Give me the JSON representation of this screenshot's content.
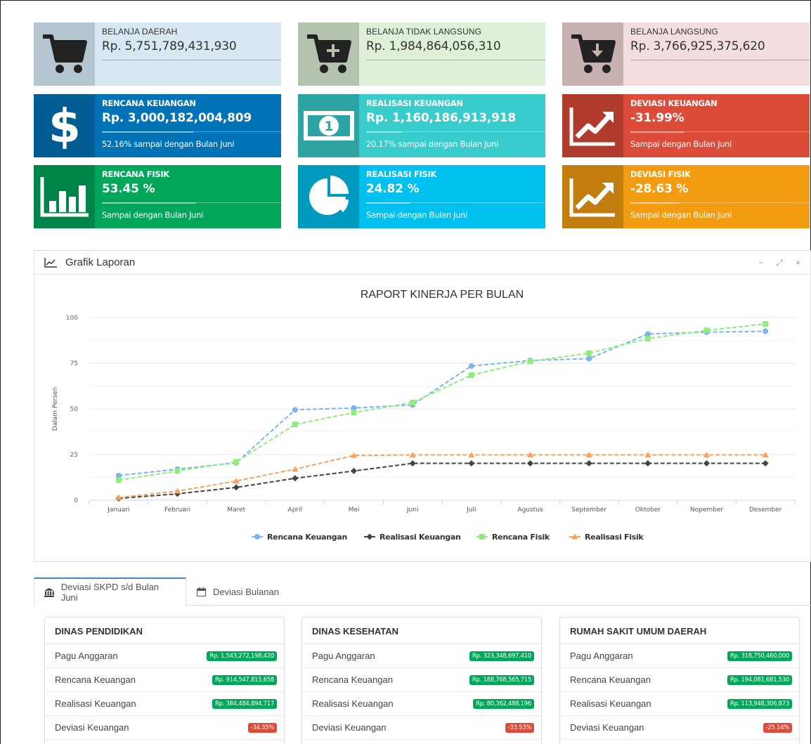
{
  "summary_tiles": [
    {
      "label": "BELANJA DAERAH",
      "value": "Rp. 5,751,789,431,930",
      "icon": "cart-icon",
      "sub": ""
    },
    {
      "label": "BELANJA TIDAK LANGSUNG",
      "value": "Rp. 1,984,864,056,310",
      "icon": "cart-plus-icon",
      "sub": ""
    },
    {
      "label": "BELANJA LANGSUNG",
      "value": "Rp. 3,766,925,375,620",
      "icon": "cart-down-icon",
      "sub": ""
    },
    {
      "label": "RENCANA KEUANGAN",
      "value": "Rp. 3,000,182,004,809",
      "icon": "dollar-icon",
      "sub": "52.16% sampai dengan Bulan Juni"
    },
    {
      "label": "REALISASI KEUANGAN",
      "value": "Rp. 1,160,186,913,918",
      "icon": "money-bill-icon",
      "sub": "20.17% sampai dengan Bulan Juni"
    },
    {
      "label": "DEVIASI KEUANGAN",
      "value": "-31.99%",
      "icon": "trend-chart-icon",
      "sub": "Sampai dengan Bulan Juni"
    },
    {
      "label": "RENCANA FISIK",
      "value": "53.45 %",
      "icon": "bar-chart-icon",
      "sub": "Sampai dengan Bulan Juni"
    },
    {
      "label": "REALISASI FISIK",
      "value": "24.82 %",
      "icon": "pie-chart-icon",
      "sub": "Sampai dengan Bulan Juni"
    },
    {
      "label": "DEVIASI FISIK",
      "value": "-28.63 %",
      "icon": "trend-chart-icon",
      "sub": "Sampai dengan Bulan Juni"
    }
  ],
  "colors": {
    "tile_light": [
      "#d8e8f3",
      "#dff0d8",
      "#f2dede"
    ],
    "tile_light_icon": [
      "#b6c6d1",
      "#b4c3ad",
      "#c6b0b0"
    ],
    "tile_color": [
      "#0073b7",
      "#39cccc",
      "#dd4b39",
      "#00a65a",
      "#00c0ef",
      "#f39c12"
    ],
    "tile_color_icon": [
      "#005c92",
      "#2ea3a3",
      "#b13c2e",
      "#008548",
      "#009abf",
      "#c27d0e"
    ]
  },
  "report_panel": {
    "title": "Grafik Laporan",
    "tools": [
      "−",
      "⤢",
      "×"
    ]
  },
  "chart_data": {
    "type": "line",
    "title": "RAPORT KINERJA PER BULAN",
    "xlabel": "",
    "ylabel": "Dalam Persen",
    "ylim": [
      0,
      100
    ],
    "yticks": [
      0,
      25,
      50,
      75,
      100
    ],
    "categories": [
      "Januari",
      "Februari",
      "Maret",
      "April",
      "Mei",
      "Juni",
      "Juli",
      "Agustus",
      "September",
      "Oktober",
      "Nopember",
      "Desember"
    ],
    "series": [
      {
        "name": "Rencana Keuangan",
        "color": "#7cb5ec",
        "marker": "circle",
        "values": [
          13.5,
          17,
          20.5,
          49.5,
          50.5,
          52.2,
          73.5,
          76.5,
          77.5,
          91,
          92,
          92.5
        ]
      },
      {
        "name": "Realisasi Keuangan",
        "color": "#434348",
        "marker": "diamond",
        "values": [
          1,
          3.5,
          7,
          12,
          16,
          20.2,
          20.2,
          20.2,
          20.2,
          20.2,
          20.2,
          20.2
        ]
      },
      {
        "name": "Rencana Fisik",
        "color": "#90ed7d",
        "marker": "square",
        "values": [
          11,
          16,
          21,
          41.5,
          48,
          53.5,
          68.5,
          76,
          80.5,
          88.5,
          93,
          96.5
        ]
      },
      {
        "name": "Realisasi Fisik",
        "color": "#f7a35c",
        "marker": "triangle",
        "values": [
          1.5,
          5,
          10.5,
          17,
          24.5,
          24.8,
          24.8,
          24.8,
          24.8,
          24.8,
          24.8,
          24.8
        ]
      }
    ],
    "grid": true,
    "legend": "bottom-center"
  },
  "tabs": [
    {
      "label": "Deviasi SKPD s/d Bulan Juni",
      "icon": "bank-icon"
    },
    {
      "label": "Deviasi Bulanan",
      "icon": "calendar-icon"
    }
  ],
  "cards": [
    {
      "title": "DINAS PENDIDIKAN",
      "rows": [
        {
          "label": "Pagu Anggaran",
          "value": "Rp. 1,543,272,198,420",
          "status": "green"
        },
        {
          "label": "Rencana Keuangan",
          "value": "Rp. 914,547,815,658",
          "status": "green"
        },
        {
          "label": "Realisasi Keuangan",
          "value": "Rp. 384,484,894,717",
          "status": "green"
        },
        {
          "label": "Deviasi Keuangan",
          "value": "-34.35%",
          "status": "red"
        }
      ]
    },
    {
      "title": "DINAS KESEHATAN",
      "rows": [
        {
          "label": "Pagu Anggaran",
          "value": "Rp. 323,348,697,410",
          "status": "green"
        },
        {
          "label": "Rencana Keuangan",
          "value": "Rp. 188,768,565,715",
          "status": "green"
        },
        {
          "label": "Realisasi Keuangan",
          "value": "Rp. 80,362,488,196",
          "status": "green"
        },
        {
          "label": "Deviasi Keuangan",
          "value": "-33.53%",
          "status": "red"
        }
      ]
    },
    {
      "title": "RUMAH SAKIT UMUM DAERAH",
      "rows": [
        {
          "label": "Pagu Anggaran",
          "value": "Rp. 318,750,460,000",
          "status": "green"
        },
        {
          "label": "Rencana Keuangan",
          "value": "Rp. 194,081,681,530",
          "status": "green"
        },
        {
          "label": "Realisasi Keuangan",
          "value": "Rp. 113,948,306,873",
          "status": "green"
        },
        {
          "label": "Deviasi Keuangan",
          "value": "-25.14%",
          "status": "red"
        }
      ]
    }
  ]
}
